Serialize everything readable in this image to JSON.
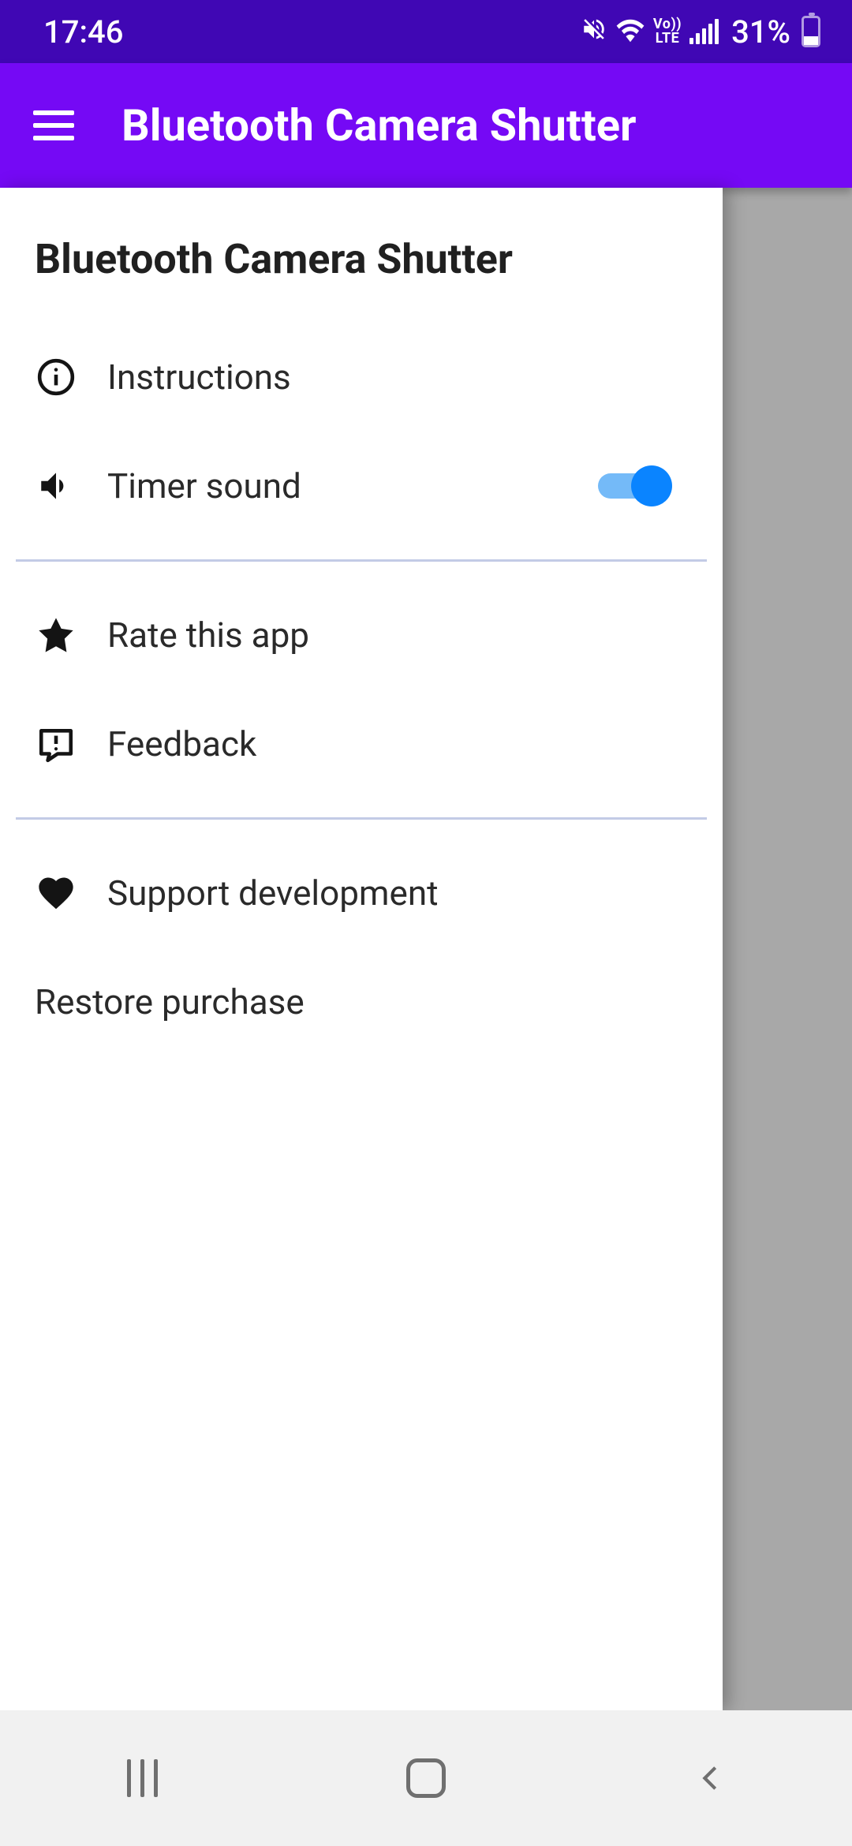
{
  "status": {
    "time": "17:46",
    "battery_pct": "31%",
    "network_type": "LTE",
    "volte": "Vo))"
  },
  "appbar": {
    "title": "Bluetooth Camera Shutter"
  },
  "drawer": {
    "title": "Bluetooth Camera Shutter",
    "items": [
      {
        "icon": "info-icon",
        "label": "Instructions"
      },
      {
        "icon": "volume-icon",
        "label": "Timer sound",
        "toggle": true
      },
      {
        "icon": "star-icon",
        "label": "Rate this app"
      },
      {
        "icon": "feedback-icon",
        "label": "Feedback"
      },
      {
        "icon": "heart-icon",
        "label": "Support development"
      },
      {
        "icon": "",
        "label": "Restore purchase"
      }
    ]
  }
}
